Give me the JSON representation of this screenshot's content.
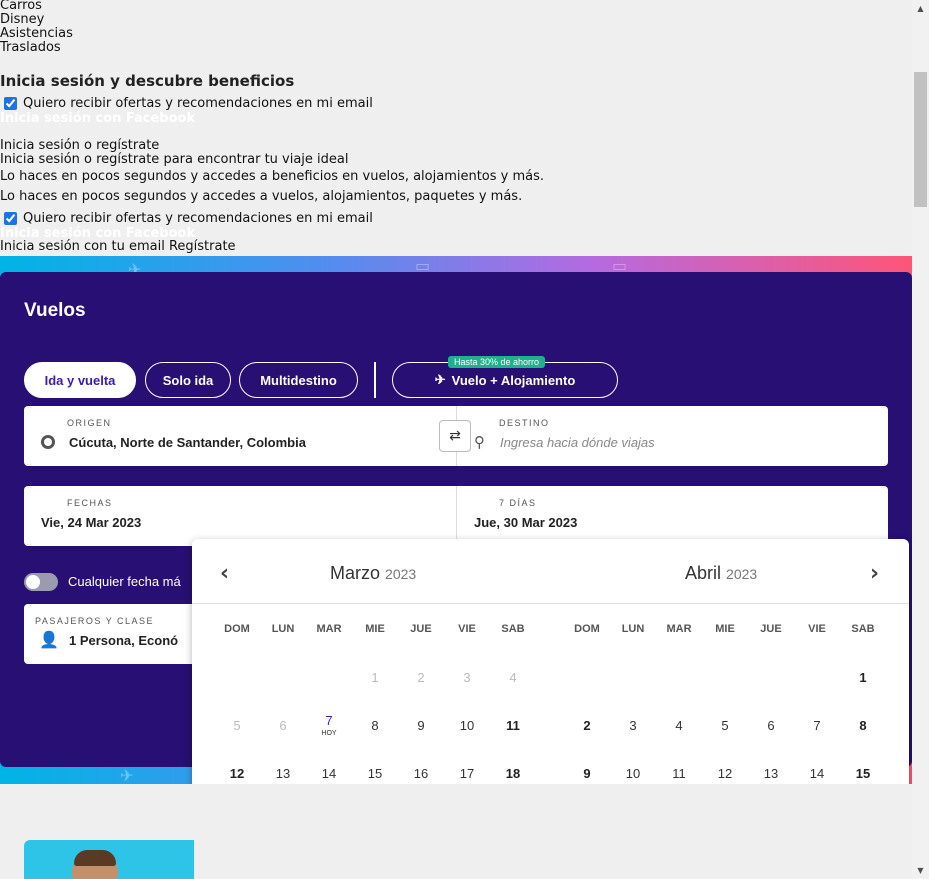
{
  "raw_menu": [
    "Carros",
    "Disney",
    "Asistencias",
    "Traslados"
  ],
  "raw_login": {
    "heading": "Inicia sesión y descubre beneficios",
    "checkbox_label": "Quiero recibir ofertas y recomendaciones en mi email",
    "facebook": "Inicia sesión con Facebook",
    "line1": "Inicia sesión o regístrate",
    "line2": "Inicia sesión o regístrate para encontrar tu viaje ideal",
    "line3": "Lo haces en pocos segundos y accedes a beneficios en vuelos, alojamientos y más.",
    "line4": "Lo haces en pocos segundos y accedes a vuelos, alojamientos, paquetes y más.",
    "checkbox_label2": "Quiero recibir ofertas y recomendaciones en mi email",
    "facebook2": "Inicia sesión con Facebook",
    "email_line": "Inicia sesión con tu email Regístrate"
  },
  "search": {
    "title": "Vuelos",
    "trip_types": [
      "Ida y vuelta",
      "Solo ida",
      "Multidestino"
    ],
    "combo_label": "Vuelo + Alojamiento",
    "combo_badge": "Hasta 30% de ahorro",
    "origin_label": "ORIGEN",
    "origin_value": "Cúcuta, Norte de Santander, Colombia",
    "dest_label": "DESTINO",
    "dest_placeholder": "Ingresa hacia dónde viajas",
    "dates_label": "FECHAS",
    "date_start": "Vie, 24 Mar 2023",
    "duration_label": "7 DÍAS",
    "date_end": "Jue, 30 Mar 2023",
    "flex_label": "Cualquier fecha má",
    "pax_label": "PASAJEROS Y CLASE",
    "pax_value": "1 Persona, Econó"
  },
  "calendar": {
    "weekdays": [
      "DOM",
      "LUN",
      "MAR",
      "MIE",
      "JUE",
      "VIE",
      "SAB"
    ],
    "months": [
      {
        "name": "Marzo",
        "year": "2023"
      },
      {
        "name": "Abril",
        "year": "2023"
      }
    ],
    "today_label": "HOY",
    "tooltip": "7 Días"
  },
  "colors": {
    "card": "#270f73",
    "selected": "#2c0f7e",
    "range": "#e9e2f8",
    "badge": "#1fb08c"
  }
}
